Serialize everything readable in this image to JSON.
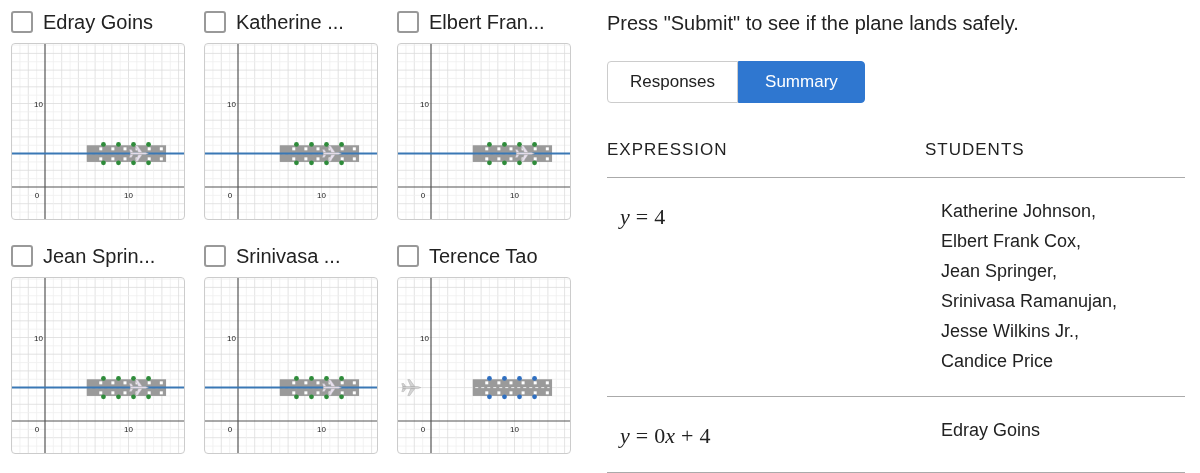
{
  "students": [
    {
      "name": "Edray Goins",
      "checked": false,
      "has_line": true,
      "landed": true,
      "labels": {
        "y_tick": "10",
        "origin": "0",
        "x_tick": "10"
      }
    },
    {
      "name": "Katherine ...",
      "checked": false,
      "has_line": true,
      "landed": true,
      "labels": {
        "y_tick": "10",
        "origin": "0",
        "x_tick": "10"
      }
    },
    {
      "name": "Elbert Fran...",
      "checked": false,
      "has_line": true,
      "landed": true,
      "labels": {
        "y_tick": "10",
        "origin": "0",
        "x_tick": "10"
      }
    },
    {
      "name": "Jean Sprin...",
      "checked": false,
      "has_line": true,
      "landed": true,
      "labels": {
        "y_tick": "10",
        "origin": "0",
        "x_tick": "10"
      }
    },
    {
      "name": "Srinivasa ...",
      "checked": false,
      "has_line": true,
      "landed": true,
      "labels": {
        "y_tick": "10",
        "origin": "0",
        "x_tick": "10"
      }
    },
    {
      "name": "Terence Tao",
      "checked": false,
      "has_line": false,
      "landed": false,
      "labels": {
        "y_tick": "10",
        "origin": "0",
        "x_tick": "10"
      }
    }
  ],
  "instruction": "Press \"Submit\" to see if the plane lands safely.",
  "tabs": [
    {
      "label": "Responses",
      "selected": false
    },
    {
      "label": "Summary",
      "selected": true
    }
  ],
  "table": {
    "columns": [
      "EXPRESSION",
      "STUDENTS"
    ],
    "rows": [
      {
        "expression": "y = 4",
        "students": [
          "Katherine Johnson,",
          "Elbert Frank Cox,",
          "Jean Springer,",
          "Srinivasa Ramanujan,",
          "Jesse Wilkins Jr.,",
          "Candice Price"
        ]
      },
      {
        "expression": "y = 0x + 4",
        "students": [
          "Edray Goins"
        ]
      }
    ]
  }
}
